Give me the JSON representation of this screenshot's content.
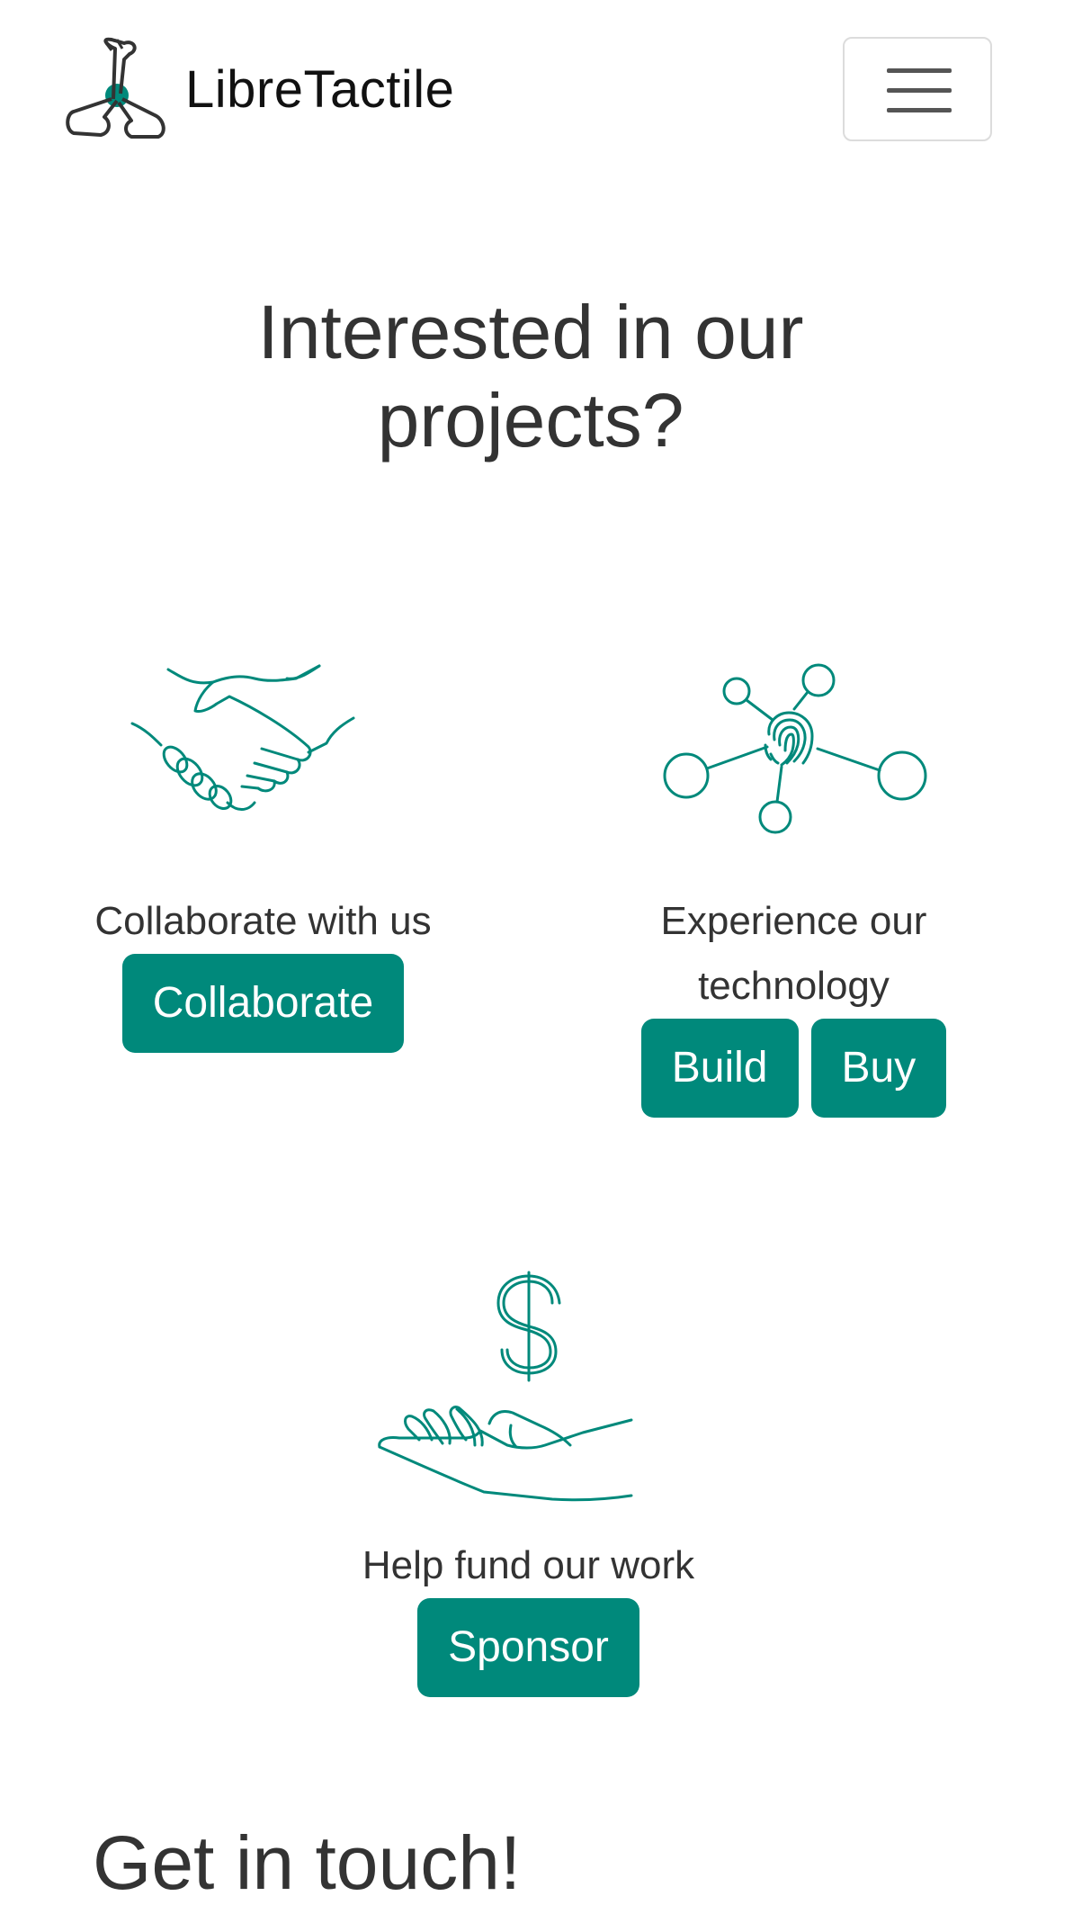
{
  "nav": {
    "brand_name": "LibreTactile",
    "logo_icon": "libretactile-logo-icon",
    "menu_icon": "hamburger-menu-icon"
  },
  "projects": {
    "title": "Interested in our projects?",
    "collaborate": {
      "icon": "handshake-icon",
      "text": "Collaborate with us",
      "button": "Collaborate"
    },
    "experience": {
      "icon": "fingerprint-network-icon",
      "text": "Experience our technology",
      "buttons": [
        "Build",
        "Buy"
      ]
    },
    "fund": {
      "icon": "hand-dollar-icon",
      "text": "Help fund our work",
      "button": "Sponsor"
    }
  },
  "contact": {
    "title": "Get in touch!"
  },
  "colors": {
    "accent": "#00897b",
    "text": "#333333",
    "background": "#ffffff"
  }
}
